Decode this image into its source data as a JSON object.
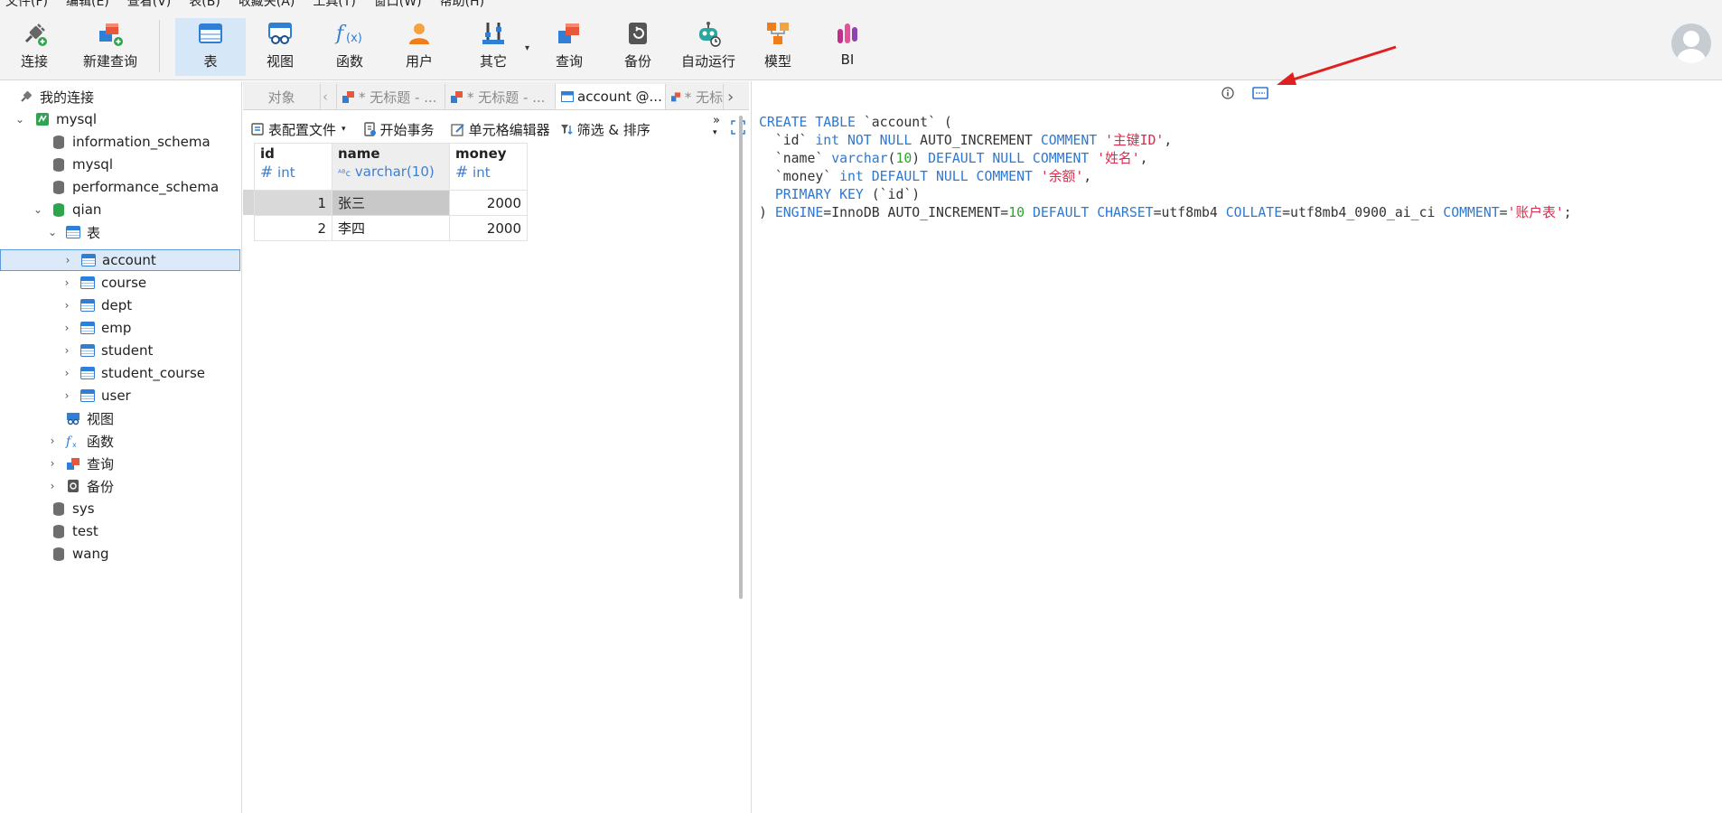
{
  "menu": [
    "文件(F)",
    "编辑(E)",
    "查看(V)",
    "表(B)",
    "收藏夹(A)",
    "工具(T)",
    "窗口(W)",
    "帮助(H)"
  ],
  "toolbar": {
    "connect": "连接",
    "new_query": "新建查询",
    "table": "表",
    "view": "视图",
    "function": "函数",
    "user": "用户",
    "other": "其它",
    "query": "查询",
    "backup": "备份",
    "automation": "自动运行",
    "model": "模型",
    "bi": "BI"
  },
  "tree": {
    "root": "我的连接",
    "connection": "mysql",
    "databases": [
      "information_schema",
      "mysql",
      "performance_schema"
    ],
    "open_db": "qian",
    "tables_group": "表",
    "tables": [
      "account",
      "course",
      "dept",
      "emp",
      "student",
      "student_course",
      "user"
    ],
    "views": "视图",
    "functions": "函数",
    "queries": "查询",
    "backups": "备份",
    "other_dbs": [
      "sys",
      "test",
      "wang"
    ]
  },
  "tabs": {
    "objects": "对象",
    "untitled1": "* 无标题 - ...",
    "untitled2": "* 无标题 - ...",
    "active": "account @...",
    "untitled3": "* 无标"
  },
  "subtoolbar": {
    "profile": "表配置文件",
    "begin_txn": "开始事务",
    "cell_editor": "单元格编辑器",
    "filter_sort": "筛选 & 排序"
  },
  "grid": {
    "columns": [
      {
        "name": "id",
        "type": "int"
      },
      {
        "name": "name",
        "type": "varchar(10)"
      },
      {
        "name": "money",
        "type": "int"
      }
    ],
    "rows": [
      {
        "id": "1",
        "name": "张三",
        "money": "2000"
      },
      {
        "id": "2",
        "name": "李四",
        "money": "2000"
      }
    ]
  },
  "ddl": {
    "l1_a": "CREATE TABLE ",
    "l1_b": "`account` (",
    "l2_a": "  `id` ",
    "l2_b": "int NOT NULL",
    "l2_c": " AUTO_INCREMENT ",
    "l2_d": "COMMENT ",
    "l2_e": "'主键ID'",
    "l2_f": ",",
    "l3_a": "  `name` ",
    "l3_b": "varchar",
    "l3_c": "(",
    "l3_d": "10",
    "l3_e": ") ",
    "l3_f": "DEFAULT NULL COMMENT ",
    "l3_g": "'姓名'",
    "l3_h": ",",
    "l4_a": "  `money` ",
    "l4_b": "int DEFAULT NULL COMMENT ",
    "l4_c": "'余额'",
    "l4_d": ",",
    "l5_a": "  ",
    "l5_b": "PRIMARY KEY",
    "l5_c": " (`id`)",
    "l6_a": ") ",
    "l6_b": "ENGINE",
    "l6_c": "=InnoDB AUTO_INCREMENT=",
    "l6_d": "10",
    "l6_e": " ",
    "l6_f": "DEFAULT CHARSET",
    "l6_g": "=utf8mb4 ",
    "l6_h": "COLLATE",
    "l6_i": "=utf8mb4_0900_ai_ci ",
    "l6_j": "COMMENT",
    "l6_k": "=",
    "l6_l": "'账户表'",
    "l6_m": ";"
  },
  "colors": {
    "accent": "#2f78d0",
    "string": "#e0284a",
    "number": "#2aa52a",
    "arrow": "#e02020"
  }
}
